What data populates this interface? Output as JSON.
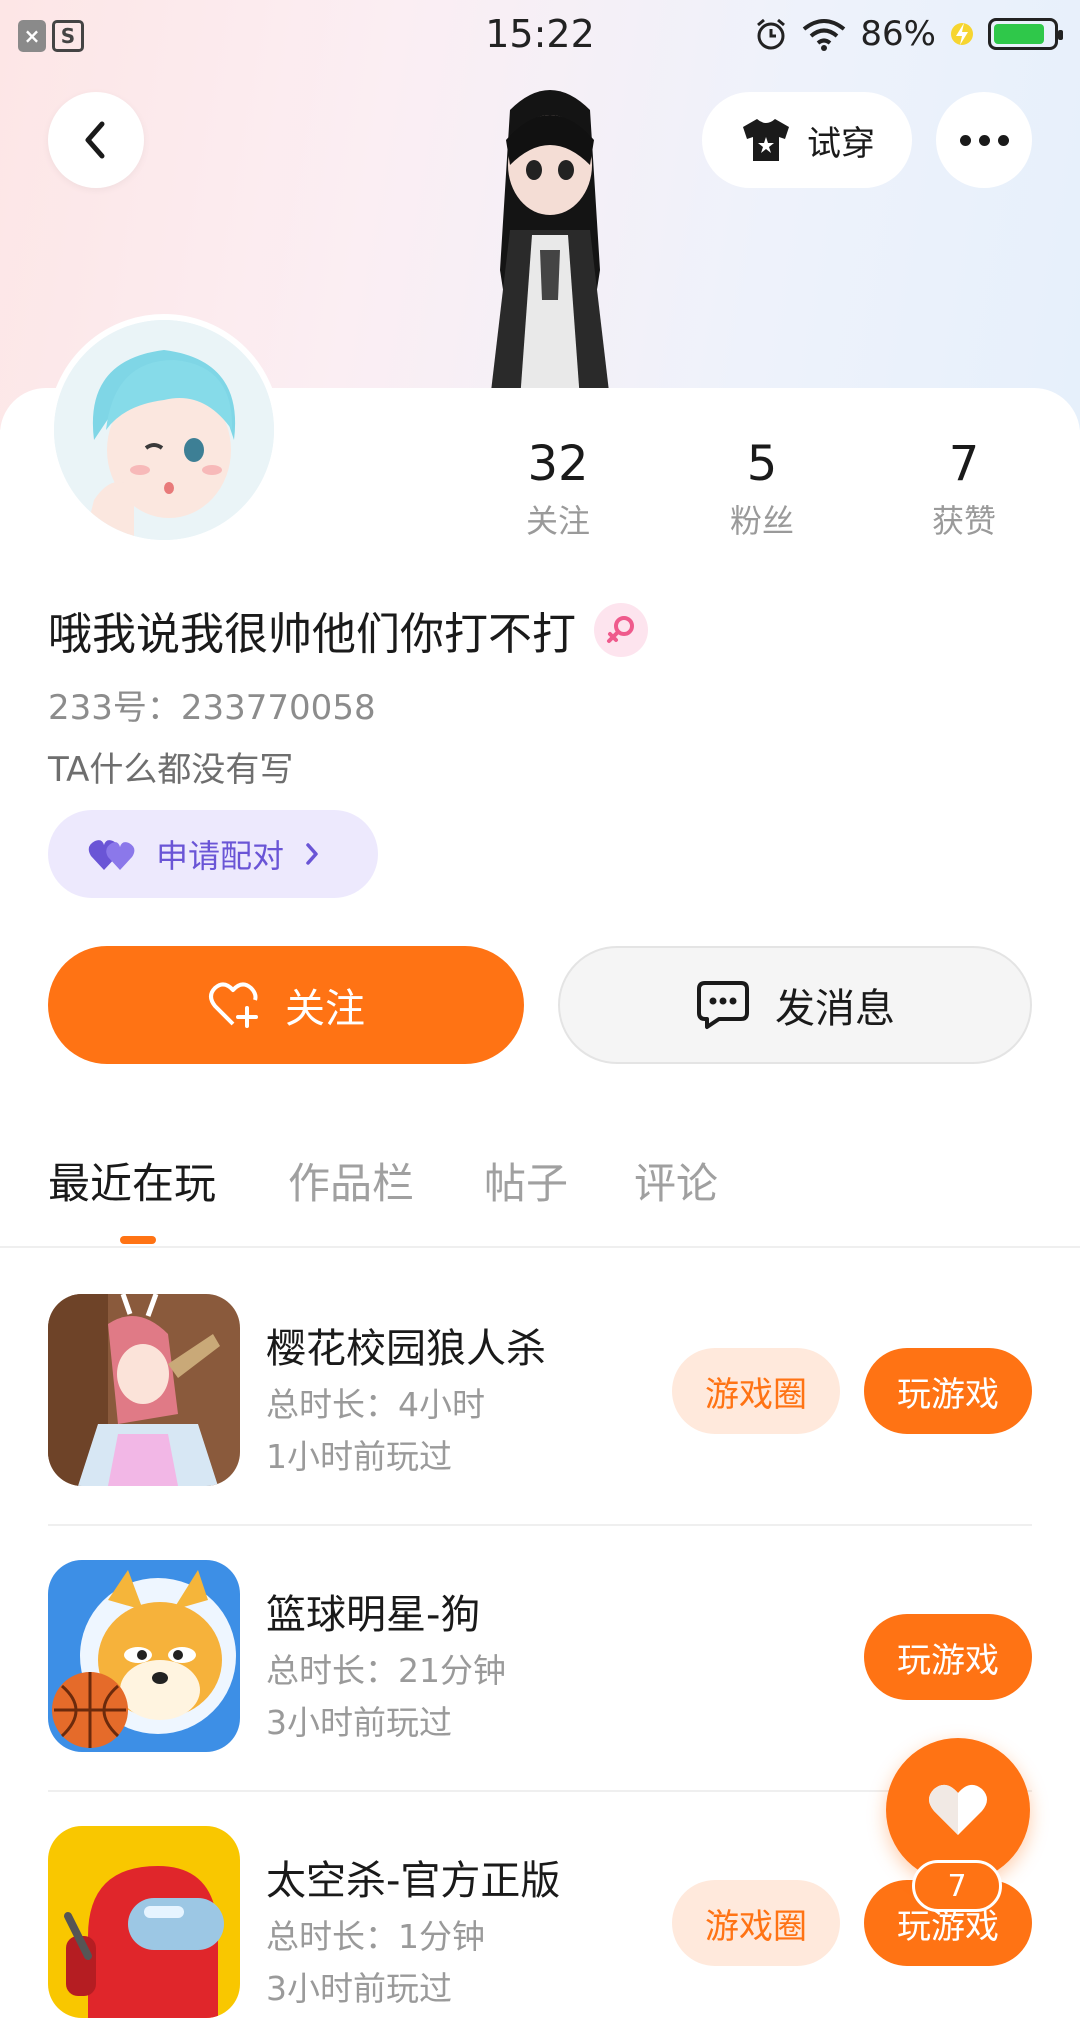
{
  "status_bar": {
    "time": "15:22",
    "battery_pct": "86%",
    "battery_level": 0.86,
    "left_icons": [
      "notification-x-icon",
      "notification-s-icon"
    ],
    "right_icons": [
      "alarm-icon",
      "wifi-icon",
      "charging-icon"
    ]
  },
  "header": {
    "tryon_label": "试穿",
    "back_icon": "chevron-left-icon",
    "more_icon": "more-dots-icon"
  },
  "profile": {
    "stats": [
      {
        "num": "32",
        "label": "关注"
      },
      {
        "num": "5",
        "label": "粉丝"
      },
      {
        "num": "7",
        "label": "获赞"
      }
    ],
    "nickname": "哦我说我很帅他们你打不打",
    "gender": "female",
    "uid": "233号：233770058",
    "bio": "TA什么都没有写",
    "pair_label": "申请配对"
  },
  "actions": {
    "follow_label": "关注",
    "message_label": "发消息"
  },
  "tabs": [
    {
      "label": "最近在玩",
      "active": true
    },
    {
      "label": "作品栏",
      "active": false
    },
    {
      "label": "帖子",
      "active": false
    },
    {
      "label": "评论",
      "active": false
    }
  ],
  "games": [
    {
      "name": "樱花校园狼人杀",
      "duration": "总时长：4小时",
      "last_played": "1小时前玩过",
      "circle_label": "游戏圈",
      "play_label": "玩游戏",
      "has_circle": true
    },
    {
      "name": "篮球明星-狗",
      "duration": "总时长：21分钟",
      "last_played": "3小时前玩过",
      "circle_label": "",
      "play_label": "玩游戏",
      "has_circle": false
    },
    {
      "name": "太空杀-官方正版",
      "duration": "总时长：1分钟",
      "last_played": "3小时前玩过",
      "circle_label": "游戏圈",
      "play_label": "玩游戏",
      "has_circle": true
    }
  ],
  "like_fab": {
    "count": "7"
  },
  "colors": {
    "accent": "#ff7314",
    "accent_light": "#ffe9dc",
    "pair_bg": "#ede9fd",
    "pair_text": "#6a55d6"
  }
}
